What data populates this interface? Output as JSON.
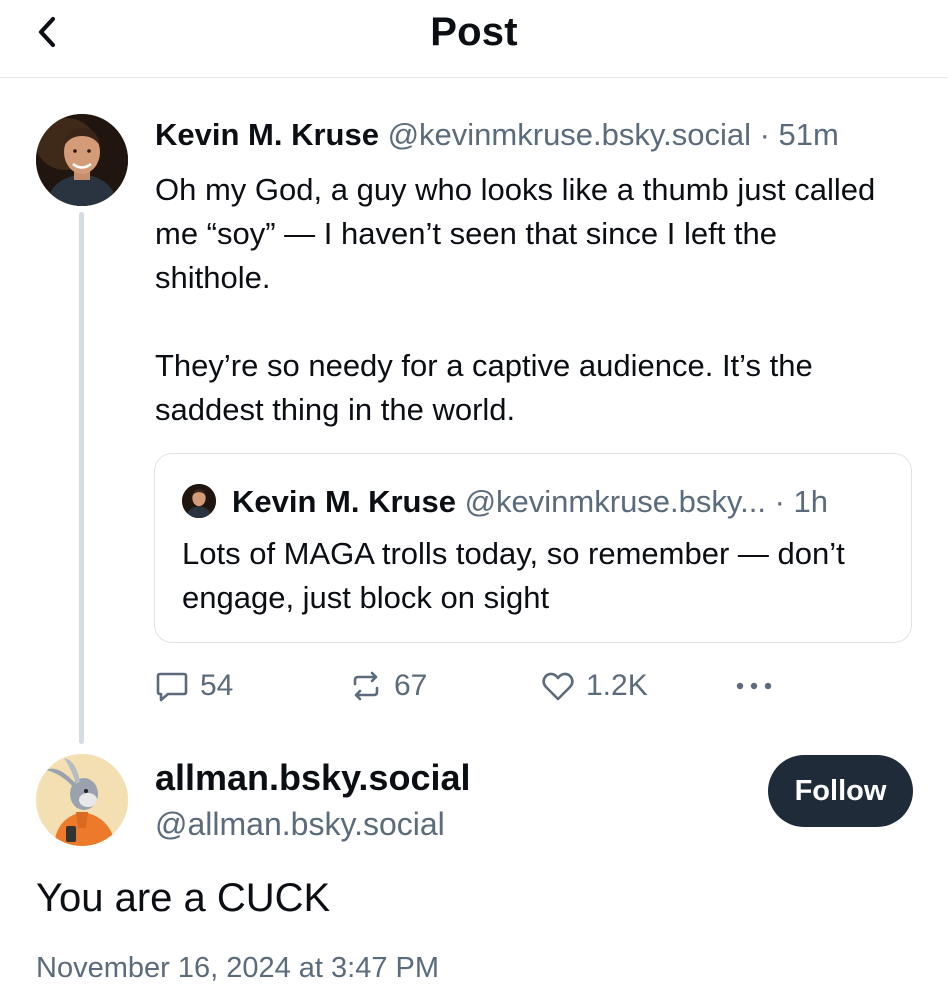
{
  "header": {
    "title": "Post",
    "back_icon": "chevron-left-icon"
  },
  "main_post": {
    "author_name": "Kevin M. Kruse",
    "handle": "@kevinmkruse.bsky.social",
    "separator": "·",
    "time": "51m",
    "paragraphs": [
      "Oh my God, a guy who looks like a thumb just called me “soy” — I haven’t seen that since I left the shithole.",
      "They’re so needy for a captive audience. It’s the saddest thing in the world."
    ],
    "quote": {
      "author_name": "Kevin M. Kruse",
      "handle": "@kevinmkruse.bsky...",
      "separator": "·",
      "time": "1h",
      "text": "Lots of MAGA trolls today, so remember — don’t engage, just block on sight"
    },
    "actions": {
      "replies": "54",
      "reposts": "67",
      "likes": "1.2K",
      "icons": [
        "comment-icon",
        "repost-icon",
        "heart-icon",
        "more-icon"
      ]
    }
  },
  "reply_post": {
    "display_name": "allman.bsky.social",
    "handle": "@allman.bsky.social",
    "follow_label": "Follow",
    "text": "You are a CUCK",
    "timestamp": "November 16, 2024 at 3:47 PM"
  },
  "colors": {
    "text": "#0b0f14",
    "muted": "#5b6b7c",
    "follow_button": "#1f2b39",
    "thread_line": "#d4dbe2",
    "divider": "#e6e8eb"
  }
}
